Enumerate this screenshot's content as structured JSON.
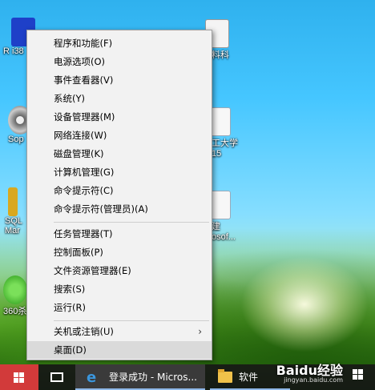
{
  "desktop": {
    "icons": [
      {
        "label": "R i38"
      },
      {
        "label": "Sop"
      },
      {
        "label": "SQL"
      },
      {
        "label": "Mar"
      },
      {
        "label": "360杀"
      },
      {
        "label": "料科"
      },
      {
        "label": "工大学"
      },
      {
        "label": "15"
      },
      {
        "label": "建"
      },
      {
        "label": "osof..."
      }
    ]
  },
  "context_menu": {
    "items": [
      {
        "label": "程序和功能(F)"
      },
      {
        "label": "电源选项(O)"
      },
      {
        "label": "事件查看器(V)"
      },
      {
        "label": "系统(Y)"
      },
      {
        "label": "设备管理器(M)"
      },
      {
        "label": "网络连接(W)"
      },
      {
        "label": "磁盘管理(K)"
      },
      {
        "label": "计算机管理(G)"
      },
      {
        "label": "命令提示符(C)"
      },
      {
        "label": "命令提示符(管理员)(A)"
      },
      {
        "label": "任务管理器(T)"
      },
      {
        "label": "控制面板(P)"
      },
      {
        "label": "文件资源管理器(E)"
      },
      {
        "label": "搜索(S)"
      },
      {
        "label": "运行(R)"
      },
      {
        "label": "关机或注销(U)"
      },
      {
        "label": "桌面(D)"
      }
    ],
    "submenu_glyph": "›"
  },
  "taskbar": {
    "edge_icon": "e",
    "edge_label": "登录成功 - Micros...",
    "folder_label": "软件",
    "start_color": "#d23a3a"
  },
  "watermark": {
    "brand": "Baidu经验",
    "url": "jingyan.baidu.com"
  }
}
